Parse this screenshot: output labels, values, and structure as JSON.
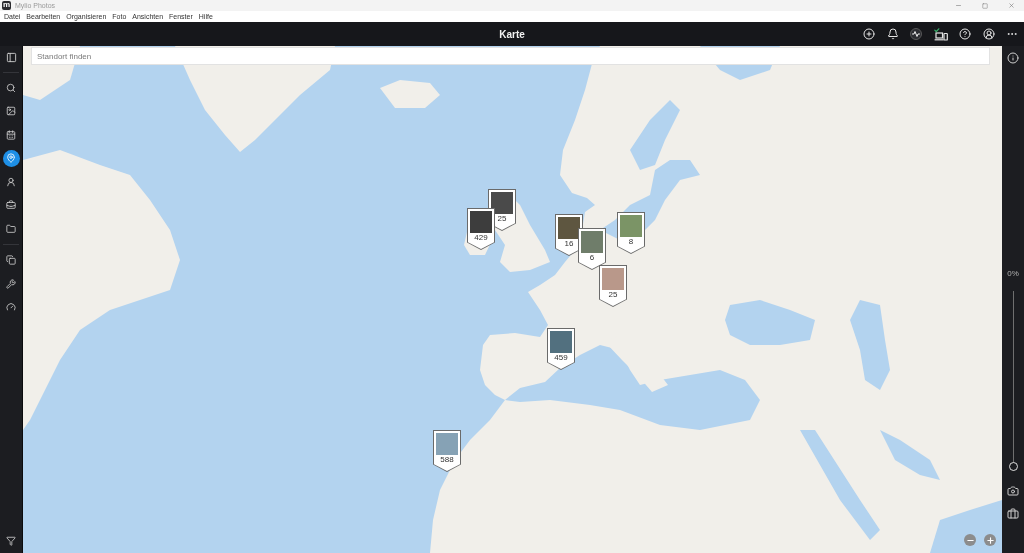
{
  "window": {
    "logo": "m",
    "title": "Mylio Photos"
  },
  "menu": [
    "Datei",
    "Bearbeiten",
    "Organisieren",
    "Foto",
    "Ansichten",
    "Fenster",
    "Hilfe"
  ],
  "toolbar": {
    "title": "Karte"
  },
  "sidebar": {
    "groups": [
      {
        "items": [
          {
            "selected": false
          },
          {
            "selected": false
          },
          {
            "selected": false
          },
          {
            "selected": true
          },
          {
            "selected": false
          },
          {
            "selected": false
          },
          {
            "selected": false
          }
        ]
      },
      {
        "items": [
          {
            "selected": false
          },
          {
            "selected": false
          },
          {
            "selected": false
          }
        ]
      }
    ]
  },
  "map": {
    "search": {
      "placeholder": "Standort finden"
    },
    "pins": [
      {
        "count": "25"
      },
      {
        "count": "429"
      },
      {
        "count": "16"
      },
      {
        "count": "6"
      },
      {
        "count": "8"
      },
      {
        "count": "25"
      },
      {
        "count": "459"
      },
      {
        "count": "588"
      }
    ]
  },
  "right_panel": {
    "slider": {
      "reading": "0%",
      "level": 0
    }
  }
}
